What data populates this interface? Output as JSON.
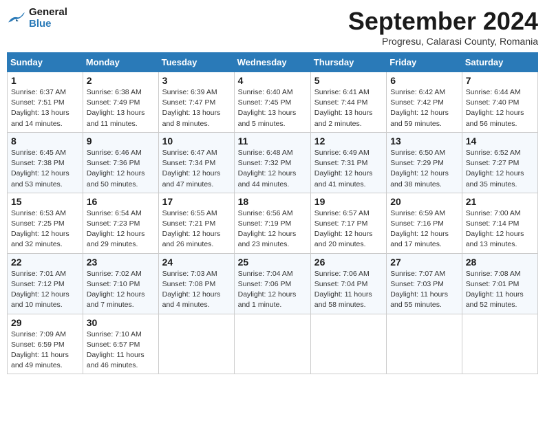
{
  "header": {
    "logo_line1": "General",
    "logo_line2": "Blue",
    "month_title": "September 2024",
    "subtitle": "Progresu, Calarasi County, Romania"
  },
  "columns": [
    "Sunday",
    "Monday",
    "Tuesday",
    "Wednesday",
    "Thursday",
    "Friday",
    "Saturday"
  ],
  "weeks": [
    [
      {
        "day": "1",
        "sunrise": "Sunrise: 6:37 AM",
        "sunset": "Sunset: 7:51 PM",
        "daylight": "Daylight: 13 hours and 14 minutes."
      },
      {
        "day": "2",
        "sunrise": "Sunrise: 6:38 AM",
        "sunset": "Sunset: 7:49 PM",
        "daylight": "Daylight: 13 hours and 11 minutes."
      },
      {
        "day": "3",
        "sunrise": "Sunrise: 6:39 AM",
        "sunset": "Sunset: 7:47 PM",
        "daylight": "Daylight: 13 hours and 8 minutes."
      },
      {
        "day": "4",
        "sunrise": "Sunrise: 6:40 AM",
        "sunset": "Sunset: 7:45 PM",
        "daylight": "Daylight: 13 hours and 5 minutes."
      },
      {
        "day": "5",
        "sunrise": "Sunrise: 6:41 AM",
        "sunset": "Sunset: 7:44 PM",
        "daylight": "Daylight: 13 hours and 2 minutes."
      },
      {
        "day": "6",
        "sunrise": "Sunrise: 6:42 AM",
        "sunset": "Sunset: 7:42 PM",
        "daylight": "Daylight: 12 hours and 59 minutes."
      },
      {
        "day": "7",
        "sunrise": "Sunrise: 6:44 AM",
        "sunset": "Sunset: 7:40 PM",
        "daylight": "Daylight: 12 hours and 56 minutes."
      }
    ],
    [
      {
        "day": "8",
        "sunrise": "Sunrise: 6:45 AM",
        "sunset": "Sunset: 7:38 PM",
        "daylight": "Daylight: 12 hours and 53 minutes."
      },
      {
        "day": "9",
        "sunrise": "Sunrise: 6:46 AM",
        "sunset": "Sunset: 7:36 PM",
        "daylight": "Daylight: 12 hours and 50 minutes."
      },
      {
        "day": "10",
        "sunrise": "Sunrise: 6:47 AM",
        "sunset": "Sunset: 7:34 PM",
        "daylight": "Daylight: 12 hours and 47 minutes."
      },
      {
        "day": "11",
        "sunrise": "Sunrise: 6:48 AM",
        "sunset": "Sunset: 7:32 PM",
        "daylight": "Daylight: 12 hours and 44 minutes."
      },
      {
        "day": "12",
        "sunrise": "Sunrise: 6:49 AM",
        "sunset": "Sunset: 7:31 PM",
        "daylight": "Daylight: 12 hours and 41 minutes."
      },
      {
        "day": "13",
        "sunrise": "Sunrise: 6:50 AM",
        "sunset": "Sunset: 7:29 PM",
        "daylight": "Daylight: 12 hours and 38 minutes."
      },
      {
        "day": "14",
        "sunrise": "Sunrise: 6:52 AM",
        "sunset": "Sunset: 7:27 PM",
        "daylight": "Daylight: 12 hours and 35 minutes."
      }
    ],
    [
      {
        "day": "15",
        "sunrise": "Sunrise: 6:53 AM",
        "sunset": "Sunset: 7:25 PM",
        "daylight": "Daylight: 12 hours and 32 minutes."
      },
      {
        "day": "16",
        "sunrise": "Sunrise: 6:54 AM",
        "sunset": "Sunset: 7:23 PM",
        "daylight": "Daylight: 12 hours and 29 minutes."
      },
      {
        "day": "17",
        "sunrise": "Sunrise: 6:55 AM",
        "sunset": "Sunset: 7:21 PM",
        "daylight": "Daylight: 12 hours and 26 minutes."
      },
      {
        "day": "18",
        "sunrise": "Sunrise: 6:56 AM",
        "sunset": "Sunset: 7:19 PM",
        "daylight": "Daylight: 12 hours and 23 minutes."
      },
      {
        "day": "19",
        "sunrise": "Sunrise: 6:57 AM",
        "sunset": "Sunset: 7:17 PM",
        "daylight": "Daylight: 12 hours and 20 minutes."
      },
      {
        "day": "20",
        "sunrise": "Sunrise: 6:59 AM",
        "sunset": "Sunset: 7:16 PM",
        "daylight": "Daylight: 12 hours and 17 minutes."
      },
      {
        "day": "21",
        "sunrise": "Sunrise: 7:00 AM",
        "sunset": "Sunset: 7:14 PM",
        "daylight": "Daylight: 12 hours and 13 minutes."
      }
    ],
    [
      {
        "day": "22",
        "sunrise": "Sunrise: 7:01 AM",
        "sunset": "Sunset: 7:12 PM",
        "daylight": "Daylight: 12 hours and 10 minutes."
      },
      {
        "day": "23",
        "sunrise": "Sunrise: 7:02 AM",
        "sunset": "Sunset: 7:10 PM",
        "daylight": "Daylight: 12 hours and 7 minutes."
      },
      {
        "day": "24",
        "sunrise": "Sunrise: 7:03 AM",
        "sunset": "Sunset: 7:08 PM",
        "daylight": "Daylight: 12 hours and 4 minutes."
      },
      {
        "day": "25",
        "sunrise": "Sunrise: 7:04 AM",
        "sunset": "Sunset: 7:06 PM",
        "daylight": "Daylight: 12 hours and 1 minute."
      },
      {
        "day": "26",
        "sunrise": "Sunrise: 7:06 AM",
        "sunset": "Sunset: 7:04 PM",
        "daylight": "Daylight: 11 hours and 58 minutes."
      },
      {
        "day": "27",
        "sunrise": "Sunrise: 7:07 AM",
        "sunset": "Sunset: 7:03 PM",
        "daylight": "Daylight: 11 hours and 55 minutes."
      },
      {
        "day": "28",
        "sunrise": "Sunrise: 7:08 AM",
        "sunset": "Sunset: 7:01 PM",
        "daylight": "Daylight: 11 hours and 52 minutes."
      }
    ],
    [
      {
        "day": "29",
        "sunrise": "Sunrise: 7:09 AM",
        "sunset": "Sunset: 6:59 PM",
        "daylight": "Daylight: 11 hours and 49 minutes."
      },
      {
        "day": "30",
        "sunrise": "Sunrise: 7:10 AM",
        "sunset": "Sunset: 6:57 PM",
        "daylight": "Daylight: 11 hours and 46 minutes."
      },
      null,
      null,
      null,
      null,
      null
    ]
  ]
}
